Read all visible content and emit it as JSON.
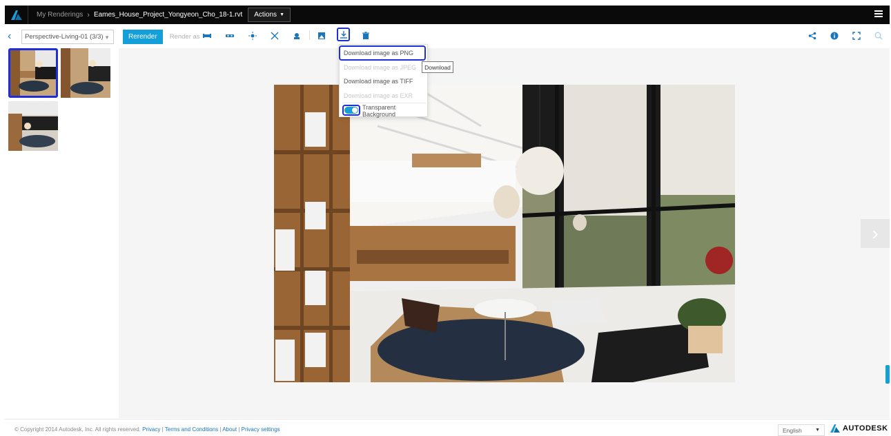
{
  "header": {
    "root_crumb": "My Renderings",
    "file_crumb": "Eames_House_Project_Yongyeon_Cho_18-1.rvt",
    "actions_label": "Actions"
  },
  "toolbar": {
    "view_select": "Perspective-Living-01 (3/3)",
    "rerender_label": "Rerender",
    "render_as_label": "Render as"
  },
  "download_menu": {
    "items": [
      {
        "label": "Download image as PNG",
        "enabled": true
      },
      {
        "label": "Download image as JPEG",
        "enabled": false
      },
      {
        "label": "Download image as TIFF",
        "enabled": true
      },
      {
        "label": "Download image as EXR",
        "enabled": false
      }
    ],
    "toggle_label": "Transparent Background",
    "toggle_on": true,
    "tooltip": "Download"
  },
  "footer": {
    "copyright": "© Copyright 2014 Autodesk, Inc. All rights reserved.",
    "links": [
      "Privacy",
      "Terms and Conditions",
      "About",
      "Privacy settings"
    ],
    "language": "English",
    "brand": "AUTODESK"
  },
  "colors": {
    "accent": "#149fd9",
    "highlight": "#1c2fd9",
    "topbar": "#0a0a0a"
  }
}
